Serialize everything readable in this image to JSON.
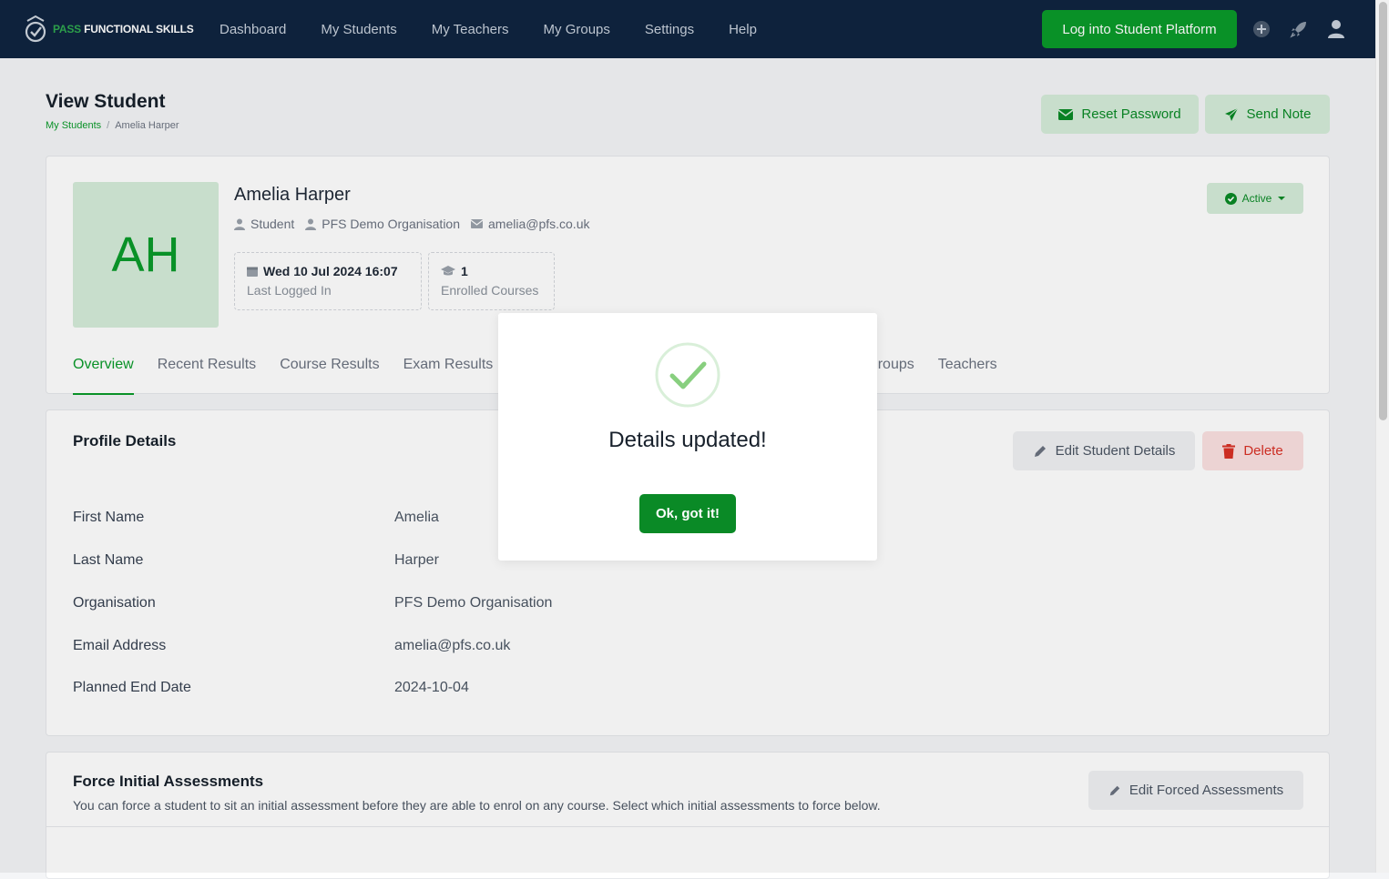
{
  "brand": {
    "pass": "PASS",
    "rest": "FUNCTIONAL SKILLS",
    "accent": "#0a9b2a",
    "nav_bg": "#0f2540"
  },
  "nav": {
    "links": [
      "Dashboard",
      "My Students",
      "My Teachers",
      "My Groups",
      "Settings",
      "Help"
    ],
    "login_button": "Log into Student Platform",
    "icons": [
      "plus-circle-icon",
      "rocket-icon",
      "user-icon"
    ]
  },
  "page": {
    "title": "View Student",
    "breadcrumb": [
      "My Students",
      "Amelia Harper"
    ],
    "reset_password": "Reset Password",
    "send_note": "Send Note"
  },
  "student": {
    "initials": "AH",
    "name": "Amelia Harper",
    "role": "Student",
    "organisation": "PFS Demo Organisation",
    "email": "amelia@pfs.co.uk",
    "status": "Active",
    "stats": [
      {
        "value": "Wed 10 Jul 2024 16:07",
        "label": "Last Logged In"
      },
      {
        "value": "1",
        "label": "Enrolled Courses"
      }
    ]
  },
  "tabs": [
    "Overview",
    "Recent Results",
    "Course Results",
    "Exam Results",
    "Groups",
    "Teachers"
  ],
  "profile": {
    "title": "Profile Details",
    "edit_button": "Edit Student Details",
    "delete_button": "Delete",
    "fields": [
      {
        "label": "First Name",
        "value": "Amelia"
      },
      {
        "label": "Last Name",
        "value": "Harper"
      },
      {
        "label": "Organisation",
        "value": "PFS Demo Organisation"
      },
      {
        "label": "Email Address",
        "value": "amelia@pfs.co.uk"
      },
      {
        "label": "Planned End Date",
        "value": "2024-10-04"
      }
    ]
  },
  "force": {
    "title": "Force Initial Assessments",
    "description": "You can force a student to sit an initial assessment before they are able to enrol on any course. Select which initial assessments to force below.",
    "edit_button": "Edit Forced Assessments"
  },
  "modal": {
    "title": "Details updated!",
    "ok_button": "Ok, got it!"
  }
}
